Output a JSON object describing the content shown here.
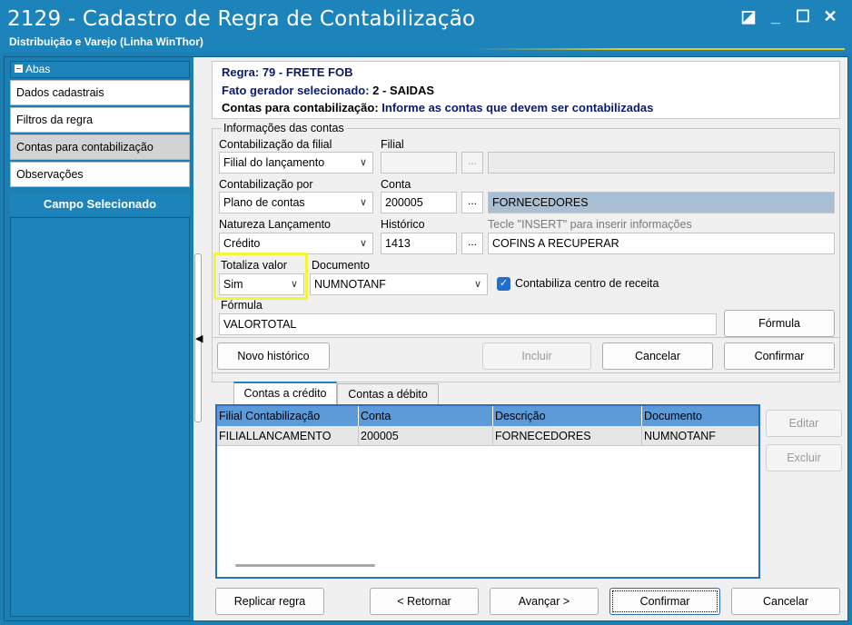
{
  "window": {
    "title": "2129 - Cadastro de Regra de Contabilização",
    "subtitle": "Distribuição e Varejo (Linha WinThor)",
    "controls": {
      "restore": "◪",
      "minimize": "_",
      "maximize": "☐",
      "close": "✕"
    }
  },
  "sidebar": {
    "header": "Abas",
    "items": [
      {
        "label": "Dados cadastrais"
      },
      {
        "label": "Filtros da regra"
      },
      {
        "label": "Contas para contabilização"
      },
      {
        "label": "Observações"
      }
    ],
    "campo_header": "Campo Selecionado"
  },
  "info": {
    "regra_label": "Regra:",
    "regra_value": "79 - FRETE FOB",
    "fato_label": "Fato gerador selecionado:",
    "fato_value": "2 - SAIDAS",
    "contas_label": "Contas para contabilização:",
    "contas_value": "Informe as contas que devem ser contabilizadas"
  },
  "form": {
    "group_title": "Informações das contas",
    "contab_filial_label": "Contabilização da filial",
    "contab_filial_value": "Filial do lançamento",
    "filial_label": "Filial",
    "filial_value": "",
    "filial_desc": "",
    "contab_por_label": "Contabilização por",
    "contab_por_value": "Plano de contas",
    "conta_label": "Conta",
    "conta_value": "200005",
    "conta_desc": "FORNECEDORES",
    "natureza_label": "Natureza Lançamento",
    "natureza_value": "Crédito",
    "historico_label": "Histórico",
    "historico_value": "1413",
    "historico_hint": "Tecle  \"INSERT\" para inserir informações",
    "historico_desc": "COFINS A RECUPERAR",
    "totaliza_label": "Totaliza valor",
    "totaliza_value": "Sim",
    "documento_label": "Documento",
    "documento_value": "NUMNOTANF",
    "centro_receita_label": "Contabiliza centro de receita",
    "centro_receita_checked": true,
    "formula_label": "Fórmula",
    "formula_value": "VALORTOTAL",
    "formula_button": "Fórmula",
    "dots": "..."
  },
  "actions": {
    "novo_historico": "Novo histórico",
    "incluir": "Incluir",
    "cancelar": "Cancelar",
    "confirmar": "Confirmar"
  },
  "tabs": [
    {
      "label": "Contas a crédito",
      "active": true
    },
    {
      "label": "Contas a débito",
      "active": false
    }
  ],
  "grid": {
    "columns": [
      "Filial Contabilização",
      "Conta",
      "Descrição",
      "Documento"
    ],
    "rows": [
      [
        "FILIALLANCAMENTO",
        "200005",
        "FORNECEDORES",
        "NUMNOTANF"
      ]
    ]
  },
  "grid_buttons": {
    "editar": "Editar",
    "excluir": "Excluir"
  },
  "footer": {
    "replicar": "Replicar regra",
    "retornar": "< Retornar",
    "avancar": "Avançar >",
    "confirmar": "Confirmar",
    "cancelar": "Cancelar"
  },
  "colors": {
    "titlebar": "#1d84bb",
    "grid_header": "#5c9ad8",
    "highlight": "#f5f53c"
  }
}
